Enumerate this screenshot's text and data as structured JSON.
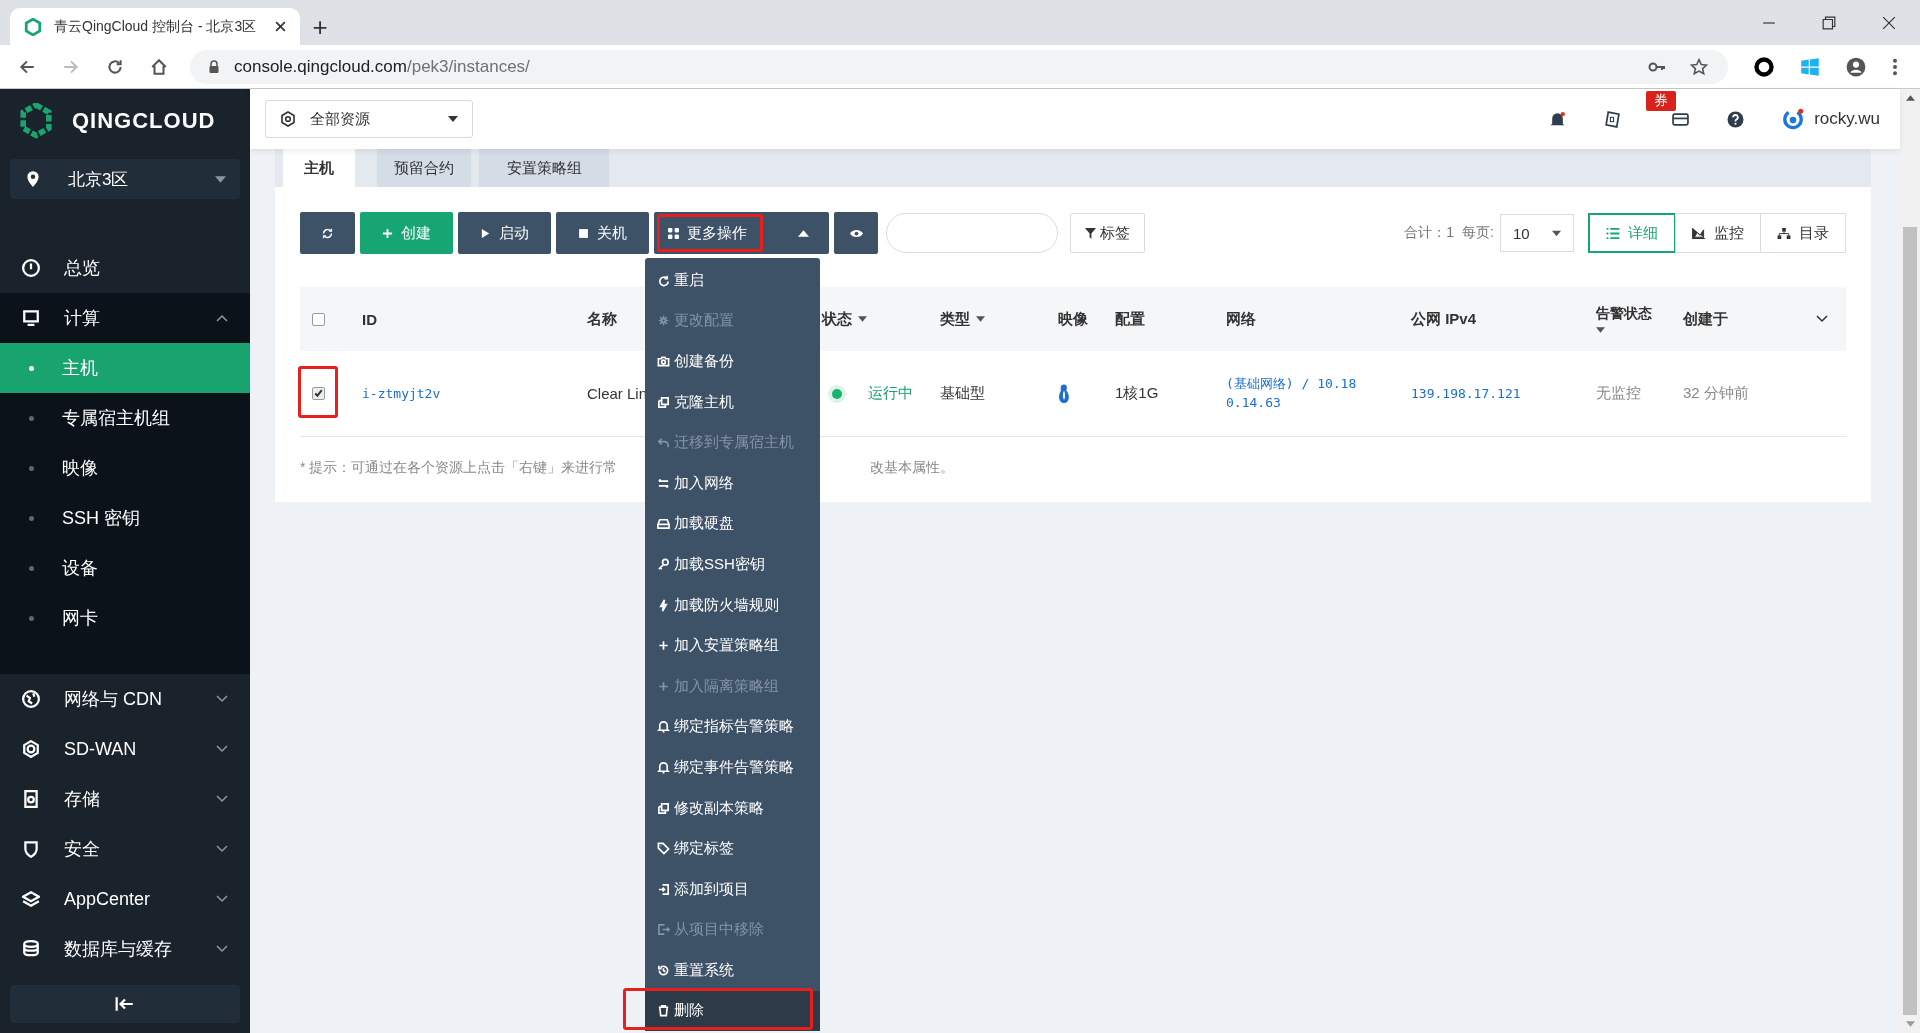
{
  "browser": {
    "tab_title": "青云QingCloud 控制台 - 北京3区",
    "new_tab": "+",
    "url_host": "console.qingcloud.com",
    "url_path": "/pek3/instances/"
  },
  "sidebar": {
    "logo": "QINGCLOUD",
    "region": "北京3区",
    "items": [
      {
        "label": "总览"
      },
      {
        "label": "计算",
        "expanded": true,
        "children": [
          {
            "label": "主机",
            "selected": true
          },
          {
            "label": "专属宿主机组",
            "selected": false
          },
          {
            "label": "映像",
            "selected": false
          },
          {
            "label": "SSH 密钥",
            "selected": false
          },
          {
            "label": "设备",
            "selected": false
          },
          {
            "label": "网卡",
            "selected": false
          }
        ]
      },
      {
        "label": "网络与 CDN",
        "expanded": false
      },
      {
        "label": "SD-WAN",
        "expanded": false
      },
      {
        "label": "存储",
        "expanded": false
      },
      {
        "label": "安全",
        "expanded": false
      },
      {
        "label": "AppCenter",
        "expanded": false
      },
      {
        "label": "数据库与缓存",
        "expanded": false
      }
    ]
  },
  "header": {
    "resource_filter": "全部资源",
    "coupon_badge": "券",
    "user": "rocky.wu"
  },
  "tabs": [
    {
      "label": "主机",
      "selected": true
    },
    {
      "label": "预留合约",
      "selected": false
    },
    {
      "label": "安置策略组",
      "selected": false
    }
  ],
  "toolbar": {
    "buttons": [
      {
        "kind": "refresh"
      },
      {
        "kind": "create",
        "label": "创建"
      },
      {
        "kind": "start",
        "label": "启动"
      },
      {
        "kind": "stop",
        "label": "关机"
      },
      {
        "kind": "more",
        "label": "更多操作",
        "expanded": true,
        "highlighted": true
      },
      {
        "kind": "view"
      }
    ],
    "tag_filter": "标签",
    "total": "合计：1",
    "per_page_label": "每页:",
    "per_page": "10",
    "views": [
      {
        "label": "详细",
        "selected": true
      },
      {
        "label": "监控",
        "selected": false
      },
      {
        "label": "目录",
        "selected": false
      }
    ]
  },
  "table": {
    "select_all_checked": false,
    "columns": [
      {
        "label": "ID",
        "sortable": false
      },
      {
        "label": "名称",
        "sortable": false
      },
      {
        "label": "状态",
        "sortable": true
      },
      {
        "label": "类型",
        "sortable": true
      },
      {
        "label": "映像",
        "sortable": false
      },
      {
        "label": "配置",
        "sortable": false
      },
      {
        "label": "网络",
        "sortable": false
      },
      {
        "label": "公网 IPv4",
        "sortable": false
      },
      {
        "label": "告警状态",
        "sortable": true
      },
      {
        "label": "创建于",
        "sortable": false
      }
    ],
    "rows": [
      {
        "checked": true,
        "highlighted": true,
        "id": "i-ztmyjt2v",
        "name": "Clear Lin",
        "status": "运行中",
        "type": "基础型",
        "config": "1核1G",
        "network": "(基础网络) / 10.180.14.63",
        "public_ip": "139.198.17.121",
        "alarm": "无监控",
        "created": "32 分钟前"
      }
    ]
  },
  "hint": [
    "* 提示：可通过在各个资源上点击「右键」来进行常",
    "改基本属性。"
  ],
  "menu": [
    {
      "label": "重启",
      "disabled": false,
      "highlighted": false
    },
    {
      "label": "更改配置",
      "disabled": true,
      "highlighted": false
    },
    {
      "label": "创建备份",
      "disabled": false,
      "highlighted": false
    },
    {
      "label": "克隆主机",
      "disabled": false,
      "highlighted": false
    },
    {
      "label": "迁移到专属宿主机",
      "disabled": true,
      "highlighted": false
    },
    {
      "label": "加入网络",
      "disabled": false,
      "highlighted": false
    },
    {
      "label": "加载硬盘",
      "disabled": false,
      "highlighted": false
    },
    {
      "label": "加载SSH密钥",
      "disabled": false,
      "highlighted": false
    },
    {
      "label": "加载防火墙规则",
      "disabled": false,
      "highlighted": false
    },
    {
      "label": "加入安置策略组",
      "disabled": false,
      "highlighted": false
    },
    {
      "label": "加入隔离策略组",
      "disabled": true,
      "highlighted": false
    },
    {
      "label": "绑定指标告警策略",
      "disabled": false,
      "highlighted": false
    },
    {
      "label": "绑定事件告警策略",
      "disabled": false,
      "highlighted": false
    },
    {
      "label": "修改副本策略",
      "disabled": false,
      "highlighted": false
    },
    {
      "label": "绑定标签",
      "disabled": false,
      "highlighted": false
    },
    {
      "label": "添加到项目",
      "disabled": false,
      "highlighted": false
    },
    {
      "label": "从项目中移除",
      "disabled": true,
      "highlighted": false
    },
    {
      "label": "重置系统",
      "disabled": false,
      "highlighted": false
    },
    {
      "label": "删除",
      "disabled": false,
      "highlighted": true
    }
  ]
}
